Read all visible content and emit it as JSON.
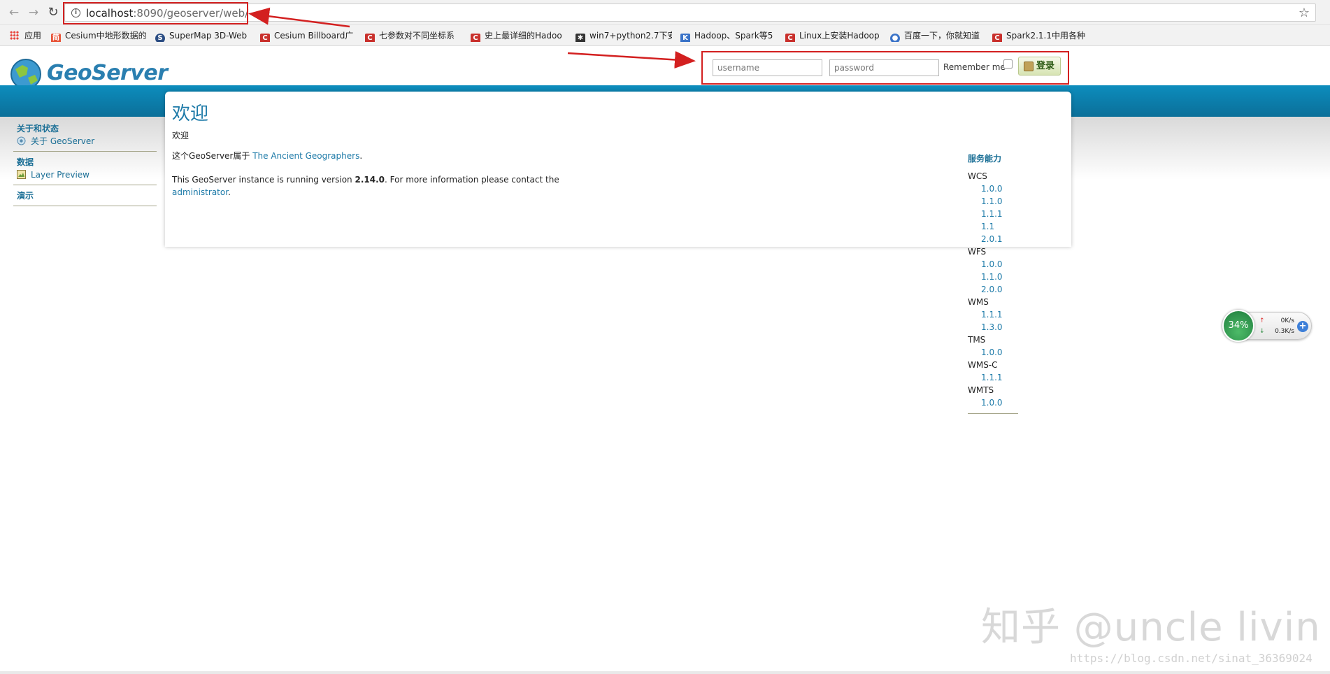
{
  "browser": {
    "url_host": "localhost",
    "url_rest": ":8090/geoserver/web/",
    "bookmarks": [
      {
        "label": "应用",
        "icon": "apps-icon"
      },
      {
        "label": "Cesium中地形数据的",
        "icon": "bookmark-icon-orange"
      },
      {
        "label": "SuperMap 3D-Web",
        "icon": "bookmark-icon-blue"
      },
      {
        "label": "Cesium Billboard广",
        "icon": "csdn-icon"
      },
      {
        "label": "七参数对不同坐标系",
        "icon": "csdn-icon"
      },
      {
        "label": "史上最详细的Hadoo",
        "icon": "csdn-icon"
      },
      {
        "label": "win7+python2.7下安",
        "icon": "cnblogs-icon"
      },
      {
        "label": "Hadoop、Spark等5",
        "icon": "kr-icon"
      },
      {
        "label": "Linux上安装Hadoop",
        "icon": "csdn-icon"
      },
      {
        "label": "百度一下，你就知道",
        "icon": "baidu-icon"
      },
      {
        "label": "Spark2.1.1中用各种",
        "icon": "csdn-icon"
      }
    ]
  },
  "header": {
    "logo_text": "GeoServer",
    "username_placeholder": "username",
    "password_placeholder": "password",
    "remember_label": "Remember me",
    "login_label": "登录"
  },
  "sidebar": {
    "sections": [
      {
        "title": "关于和状态",
        "items": [
          {
            "label": "关于 GeoServer",
            "icon": "about-icon"
          }
        ]
      },
      {
        "title": "数据",
        "items": [
          {
            "label": "Layer Preview",
            "icon": "layer-preview-icon"
          }
        ]
      },
      {
        "title": "演示",
        "items": []
      }
    ]
  },
  "main": {
    "title": "欢迎",
    "welcome": "欢迎",
    "owner_prefix": "这个GeoServer属于",
    "owner_link": "The Ancient Geographers",
    "owner_suffix": ".",
    "version_prefix": "This GeoServer instance is running version",
    "version": "2.14.0",
    "version_suffix": ". For more information please contact the",
    "admin_link": "administrator",
    "admin_suffix": "."
  },
  "capabilities": {
    "title": "服务能力",
    "services": [
      {
        "name": "WCS",
        "versions": [
          "1.0.0",
          "1.1.0",
          "1.1.1",
          "1.1",
          "2.0.1"
        ]
      },
      {
        "name": "WFS",
        "versions": [
          "1.0.0",
          "1.1.0",
          "2.0.0"
        ]
      },
      {
        "name": "WMS",
        "versions": [
          "1.1.1",
          "1.3.0"
        ]
      },
      {
        "name": "TMS",
        "versions": [
          "1.0.0"
        ]
      },
      {
        "name": "WMS-C",
        "versions": [
          "1.1.1"
        ]
      },
      {
        "name": "WMTS",
        "versions": [
          "1.0.0"
        ]
      }
    ]
  },
  "widget": {
    "percent": "34%",
    "up_speed": "0K/s",
    "down_speed": "0.3K/s"
  },
  "watermark": {
    "text": "知乎 @uncle livin",
    "url": "https://blog.csdn.net/sinat_36369024"
  },
  "colors": {
    "accent": "#1d7aa8",
    "band": "#0d8dbd",
    "annotation_red": "#d32020"
  }
}
